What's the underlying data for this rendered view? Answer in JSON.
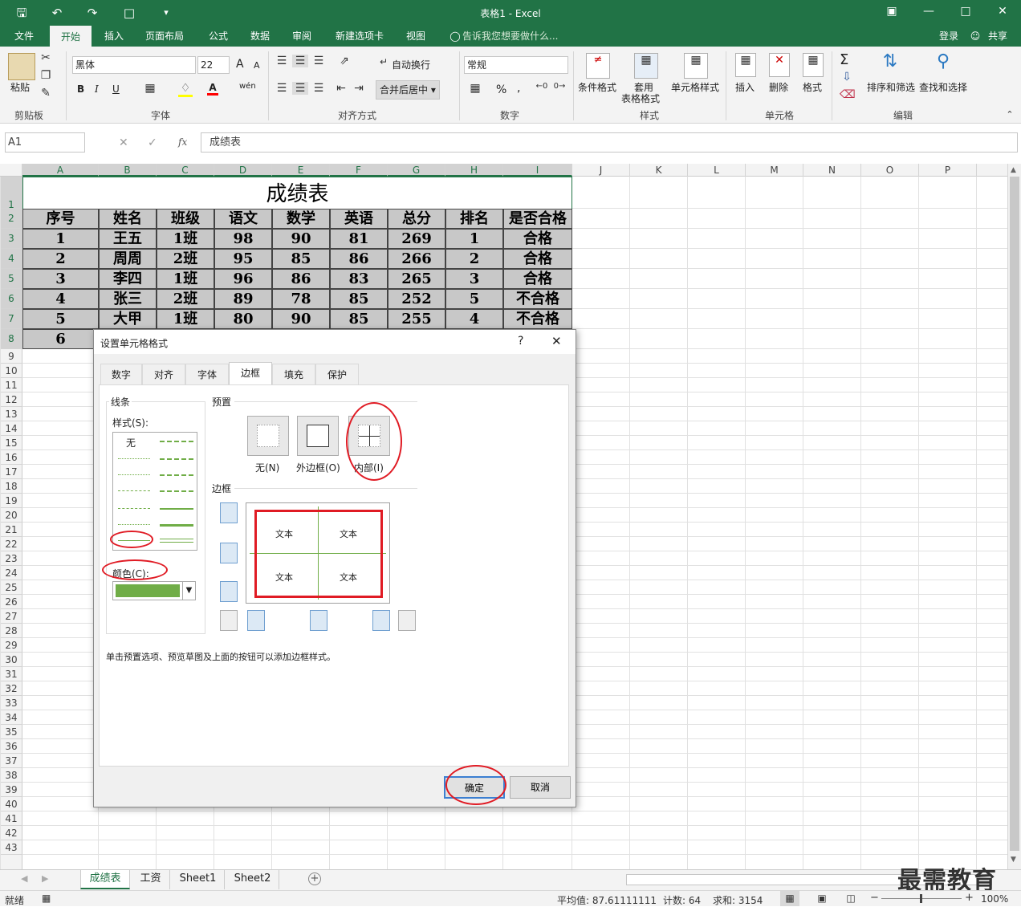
{
  "app": {
    "title": "表格1 - Excel"
  },
  "qat": {
    "save": "save-icon",
    "undo": "undo-icon",
    "redo": "redo-icon",
    "new": "new-file-icon"
  },
  "menu": {
    "tabs": [
      "文件",
      "开始",
      "插入",
      "页面布局",
      "公式",
      "数据",
      "审阅",
      "新建选项卡",
      "视图"
    ],
    "active": "开始",
    "tell_me": "告诉我您想要做什么...",
    "login": "登录",
    "share": "共享"
  },
  "ribbon": {
    "clipboard": {
      "paste": "粘贴",
      "label": "剪贴板"
    },
    "font": {
      "name": "黑体",
      "size": "22",
      "bold": "B",
      "italic": "I",
      "underline": "U",
      "color_a": "A",
      "label": "字体",
      "wen": "wén",
      "grow": "A",
      "shrink": "A"
    },
    "alignment": {
      "wrap": "自动换行",
      "merge": "合并后居中",
      "label": "对齐方式"
    },
    "number": {
      "format": "常规",
      "percent": "%",
      "comma": ",",
      "label": "数字"
    },
    "styles": {
      "conditional": "条件格式",
      "table_line1": "套用",
      "table_line2": "表格格式",
      "cell_styles": "单元格样式",
      "label": "样式"
    },
    "cells": {
      "insert": "插入",
      "delete": "删除",
      "format": "格式",
      "label": "单元格"
    },
    "editing": {
      "sort": "排序和筛选",
      "find": "查找和选择",
      "sigma": "Σ",
      "label": "编辑"
    }
  },
  "formula_bar": {
    "name_box": "A1",
    "fx": "fx",
    "content": "成绩表"
  },
  "columns": [
    "A",
    "B",
    "C",
    "D",
    "E",
    "F",
    "G",
    "H",
    "I",
    "J",
    "K",
    "L",
    "M",
    "N",
    "O",
    "P"
  ],
  "rows": [
    "1",
    "2",
    "3",
    "4",
    "5",
    "6",
    "7",
    "8",
    "9",
    "10",
    "11",
    "12",
    "13",
    "14",
    "15",
    "16",
    "17",
    "18",
    "19",
    "20",
    "21",
    "22",
    "23",
    "24",
    "25",
    "26",
    "27",
    "28",
    "29",
    "30",
    "31",
    "32",
    "33",
    "34",
    "35",
    "36",
    "37",
    "38",
    "39",
    "40",
    "41",
    "42",
    "43"
  ],
  "table": {
    "title": "成绩表",
    "headers": [
      "序号",
      "姓名",
      "班级",
      "语文",
      "数学",
      "英语",
      "总分",
      "排名",
      "是否合格"
    ],
    "rows": [
      [
        "1",
        "王五",
        "1班",
        "98",
        "90",
        "81",
        "269",
        "1",
        "合格"
      ],
      [
        "2",
        "周周",
        "2班",
        "95",
        "85",
        "86",
        "266",
        "2",
        "合格"
      ],
      [
        "3",
        "李四",
        "1班",
        "96",
        "86",
        "83",
        "265",
        "3",
        "合格"
      ],
      [
        "4",
        "张三",
        "2班",
        "89",
        "78",
        "85",
        "252",
        "5",
        "不合格"
      ],
      [
        "5",
        "大甲",
        "1班",
        "80",
        "90",
        "85",
        "255",
        "4",
        "不合格"
      ],
      [
        "6"
      ]
    ]
  },
  "dialog": {
    "title": "设置单元格格式",
    "help": "?",
    "close": "✕",
    "tabs": [
      "数字",
      "对齐",
      "字体",
      "边框",
      "填充",
      "保护"
    ],
    "active_tab": "边框",
    "line_group": "线条",
    "style_label": "样式(S):",
    "style_none": "无",
    "color_label": "颜色(C):",
    "color_value": "#70ad47",
    "preset_group": "预置",
    "presets": [
      "无(N)",
      "外边框(O)",
      "内部(I)"
    ],
    "border_group": "边框",
    "preview_text": [
      "文本",
      "文本",
      "文本",
      "文本"
    ],
    "hint": "单击预置选项、预览草图及上面的按钮可以添加边框样式。",
    "ok": "确定",
    "cancel": "取消"
  },
  "sheets": {
    "tabs": [
      "成绩表",
      "工资",
      "Sheet1",
      "Sheet2"
    ],
    "active": "成绩表",
    "add": "+"
  },
  "status": {
    "ready": "就绪",
    "average": "平均值: 87.61111111",
    "count": "计数: 64",
    "sum": "求和: 3154",
    "zoom": "100%"
  },
  "watermark": "最需教育",
  "colors": {
    "excel_green": "#217346",
    "annotation_red": "#e01b24",
    "cell_fill": "#c8c8c8"
  }
}
